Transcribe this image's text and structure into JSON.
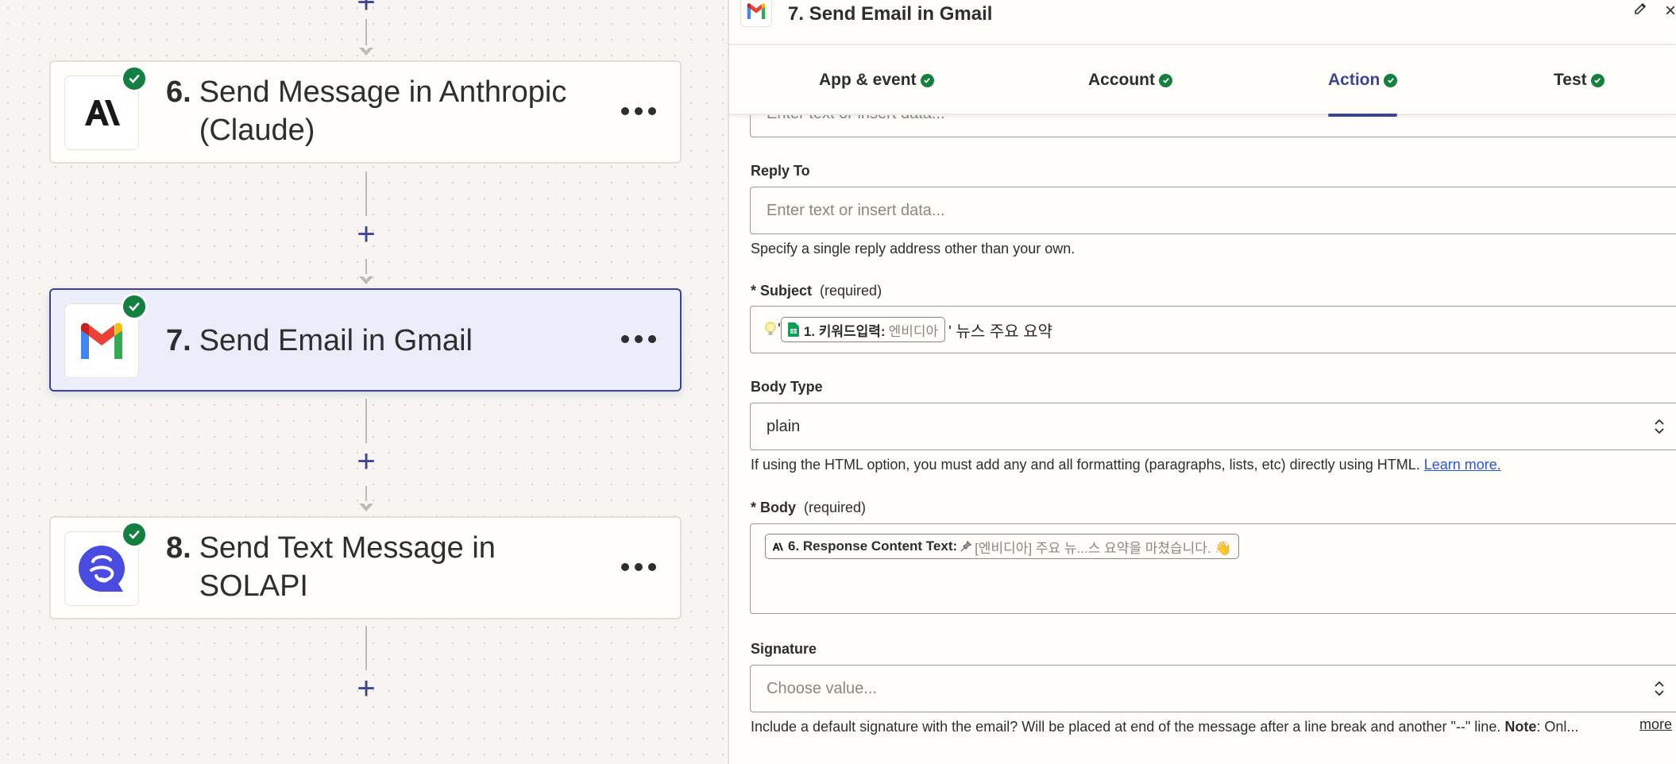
{
  "canvas": {
    "steps": [
      {
        "number": "6.",
        "title_line1": "Send Message in Anthropic",
        "title_line2": "(Claude)",
        "app": "anthropic-icon"
      },
      {
        "number": "7.",
        "title_line1": "Send Email in Gmail",
        "title_line2": "",
        "app": "gmail-icon",
        "selected": true
      },
      {
        "number": "8.",
        "title_line1": "Send Text Message in",
        "title_line2": "SOLAPI",
        "app": "solapi-icon"
      }
    ],
    "plus_label": "+"
  },
  "panel": {
    "title": "7. Send Email in Gmail",
    "close_label": "×",
    "tabs": [
      {
        "label": "App & event",
        "status": "complete"
      },
      {
        "label": "Account",
        "status": "complete"
      },
      {
        "label": "Action",
        "status": "complete",
        "active": true
      },
      {
        "label": "Test",
        "status": "complete"
      }
    ],
    "prev_field_placeholder": "Enter text or insert data...",
    "reply_to": {
      "label": "Reply To",
      "placeholder": "Enter text or insert data...",
      "help": "Specify a single reply address other than your own."
    },
    "subject": {
      "label": "* Subject",
      "required": "(required)",
      "prefix": "' ",
      "pill_key": "1. 키워드입력:",
      "pill_value": "엔비디아",
      "suffix": "' 뉴스 주요 요약"
    },
    "body_type": {
      "label": "Body Type",
      "value": "plain",
      "help": "If using the HTML option, you must add any and all formatting (paragraphs, lists, etc) directly using HTML.",
      "help_link": "Learn more."
    },
    "body": {
      "label": "* Body",
      "required": "(required)",
      "pill_key": "6. Response Content Text:",
      "pill_value": "[엔비디아] 주요 뉴...스 요약을 마쳤습니다. 👋"
    },
    "signature": {
      "label": "Signature",
      "placeholder": "Choose value...",
      "help": "Include a default signature with the email? Will be placed at end of the message after a line break and another \"--\" line.",
      "help_note_label": "Note",
      "help_note": ": Onl...",
      "more": "more"
    }
  },
  "colors": {
    "accent": "#3d4592",
    "success": "#138041",
    "link": "#2f55d4"
  }
}
